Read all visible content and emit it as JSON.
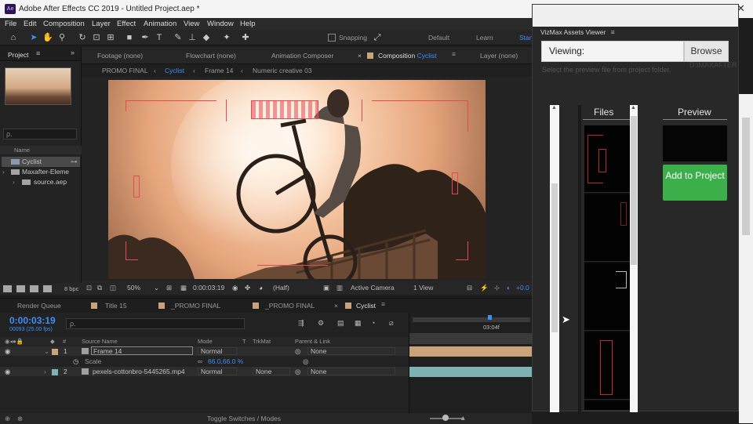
{
  "window": {
    "title": "Adobe After Effects CC 2019 - Untitled Project.aep *",
    "app_icon": "Ae"
  },
  "menu": [
    "File",
    "Edit",
    "Composition",
    "Layer",
    "Effect",
    "Animation",
    "View",
    "Window",
    "Help"
  ],
  "toolbar": {
    "snapping": "Snapping",
    "workspaces": [
      "Default",
      "Learn",
      "Stan"
    ]
  },
  "project": {
    "tab": "Project",
    "search_placeholder": "ρ.",
    "name_col": "Name",
    "items": [
      {
        "name": "Cyclist",
        "type": "comp"
      },
      {
        "name": "Maxafter-Eleme",
        "type": "folder"
      },
      {
        "name": "source.aep",
        "type": "folder"
      }
    ],
    "bpc": "8 bpc"
  },
  "viewer": {
    "tabs": [
      "Footage (none)",
      "Flowchart (none)",
      "Animation Composer",
      "Composition Cyclist",
      "Layer (none)"
    ],
    "comp_prefix": "Composition",
    "comp_name": "Cyclist",
    "breadcrumbs": [
      "PROMO FINAL",
      "Cyclist",
      "Frame 14",
      "Numeric creative 03"
    ],
    "zoom": "50%",
    "timecode": "0:00:03:19",
    "resolution": "(Half)",
    "camera": "Active Camera",
    "view": "1 View",
    "offset": "+0.0"
  },
  "timeline": {
    "tabs": [
      "Render Queue",
      "Title 15",
      "_PROMO FINAL",
      "_PROMO FINAL",
      "Cyclist"
    ],
    "timecode": "0:00:03:19",
    "frames": "00093 (25.00 fps)",
    "search_placeholder": "ρ.",
    "marker": "03:04f",
    "columns": {
      "source": "Source Name",
      "mode": "Mode",
      "t": "T",
      "trkmat": "TrkMat",
      "parent": "Parent & Link"
    },
    "layers": [
      {
        "num": "1",
        "name": "Frame 14",
        "mode": "Normal",
        "parent": "None",
        "color": "#c9a37a"
      },
      {
        "num": "2",
        "name": "pexels-cottonbro-5445265.mp4",
        "mode": "Normal",
        "trkmat": "None",
        "parent": "None",
        "color": "#7fb2b3"
      }
    ],
    "property": {
      "name": "Scale",
      "value": "66.0,66.0 %"
    },
    "footer": "Toggle Switches / Modes"
  },
  "assets_panel": {
    "title": "VizMax Assets Viewer",
    "viewing_label": "Viewing:",
    "browse": "Browse",
    "hint": "Select the preview file from project folder.",
    "files_header": "Files",
    "preview_header": "Preview",
    "add_button": "Add to Project",
    "overlay_path": "D:\\MAXAFTER ANIM CC\\punk\\punk\\pre"
  }
}
